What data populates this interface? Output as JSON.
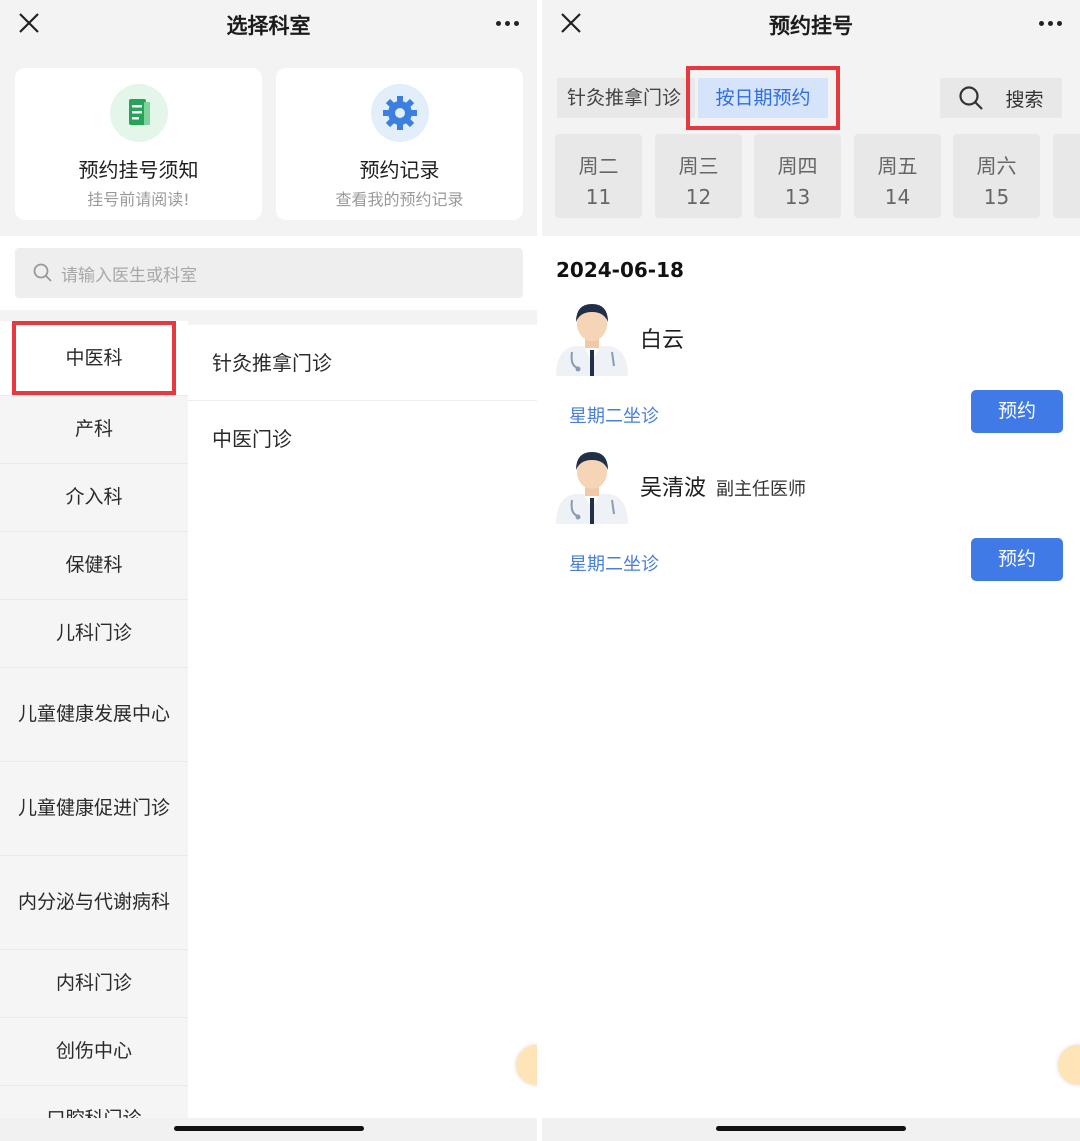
{
  "left": {
    "title": "选择科室",
    "cards": [
      {
        "title": "预约挂号须知",
        "subtitle": "挂号前请阅读!",
        "icon": "document-icon"
      },
      {
        "title": "预约记录",
        "subtitle": "查看我的预约记录",
        "icon": "gear-icon"
      }
    ],
    "search": {
      "placeholder": "请输入医生或科室"
    },
    "departments": [
      "中医科",
      "产科",
      "介入科",
      "保健科",
      "儿科门诊",
      "儿童健康发展中心",
      "儿童健康促进门诊",
      "内分泌与代谢病科",
      "内科门诊",
      "创伤中心",
      "口腔科门诊"
    ],
    "clinics": [
      "针灸推拿门诊",
      "中医门诊"
    ]
  },
  "right": {
    "title": "预约挂号",
    "tabs": {
      "clinic": "针灸推拿门诊",
      "by_date": "按日期预约"
    },
    "search_label": "搜索",
    "days": [
      {
        "weekday": "周二",
        "date": "11"
      },
      {
        "weekday": "周三",
        "date": "12"
      },
      {
        "weekday": "周四",
        "date": "13"
      },
      {
        "weekday": "周五",
        "date": "14"
      },
      {
        "weekday": "周六",
        "date": "15"
      }
    ],
    "date": "2024-06-18",
    "doctors": [
      {
        "name": "白云",
        "title": "",
        "schedule": "星期二坐诊",
        "button": "预约"
      },
      {
        "name": "吴清波",
        "title": "副主任医师",
        "schedule": "星期二坐诊",
        "button": "预约"
      }
    ]
  },
  "colors": {
    "accent": "#3f7ae6",
    "highlight": "#e8383f",
    "link": "#4a7fd8"
  }
}
